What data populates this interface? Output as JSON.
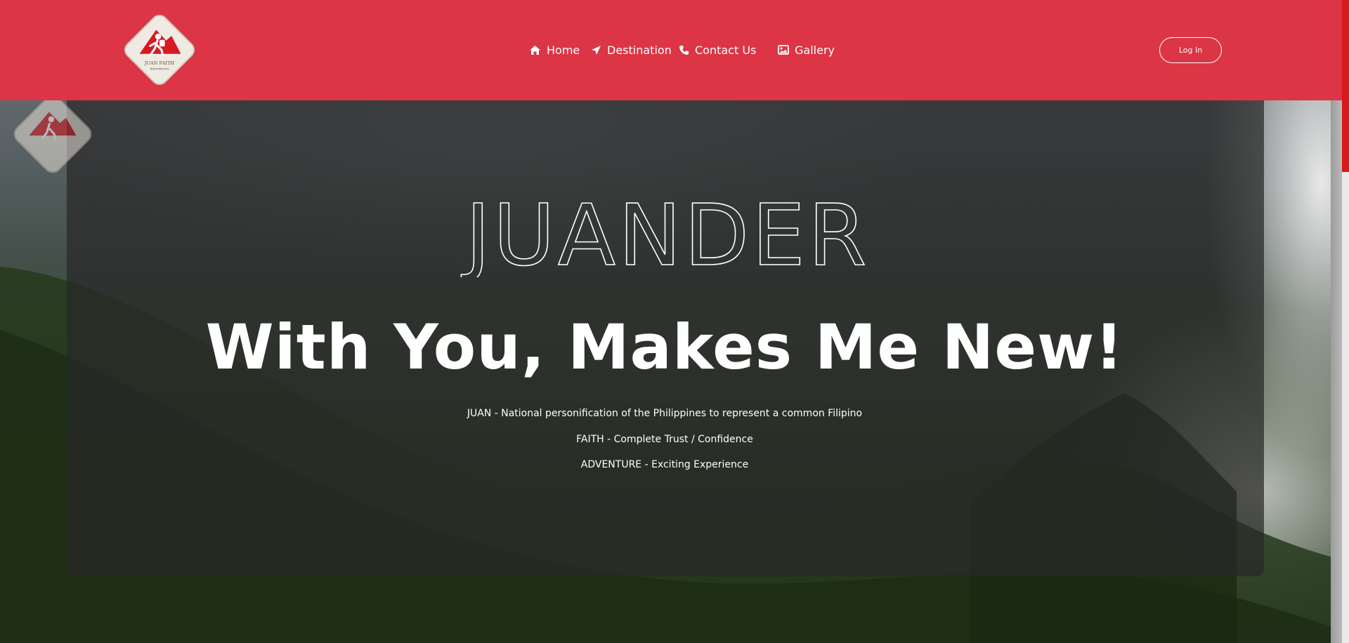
{
  "header": {
    "logo_text": "JUAN FAITH",
    "logo_subtext": "Adventures",
    "nav": [
      {
        "label": "Home",
        "icon": "home-icon"
      },
      {
        "label": "Destination",
        "icon": "paper-plane-icon"
      },
      {
        "label": "Contact Us",
        "icon": "phone-icon"
      },
      {
        "label": "Gallery",
        "icon": "image-icon"
      }
    ],
    "login_label": "Log In"
  },
  "hero": {
    "brand": "JUANDER",
    "tagline": "With You, Makes Me New!",
    "definitions": [
      "JUAN - National personification of the Philippines to represent a common Filipino",
      "FAITH - Complete Trust / Confidence",
      "ADVENTURE - Exciting Experience"
    ]
  },
  "colors": {
    "header_bg": "#dc3545",
    "scroll_thumb": "#d91a1a",
    "text": "#ffffff"
  }
}
